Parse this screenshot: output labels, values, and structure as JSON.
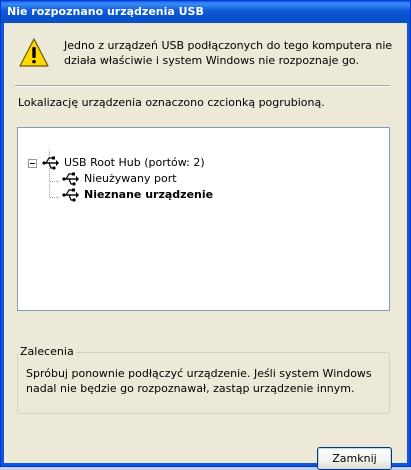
{
  "window": {
    "title": "Nie rozpoznano urządzenia USB"
  },
  "message": {
    "icon": "warning-icon",
    "text": "Jedno z urządzeń USB podłączonych do tego komputera nie działa właściwie i system Windows nie rozpoznaje go."
  },
  "location_label": "Lokalizację urządzenia oznaczono czcionką pogrubioną.",
  "tree": {
    "root": {
      "label": "USB Root Hub (portów: 2)",
      "icon": "usb-icon",
      "expanded": true
    },
    "children": [
      {
        "label": "Nieużywany port",
        "icon": "usb-icon",
        "bold": false
      },
      {
        "label": "Nieznane urządzenie",
        "icon": "usb-icon",
        "bold": true
      }
    ]
  },
  "recommendation": {
    "legend": "Zalecenia",
    "text": "Spróbuj ponownie podłączyć urządzenie. Jeśli system Windows nadal nie będzie go rozpoznawał, zastąp urządzenie innym."
  },
  "buttons": {
    "close_label": "Zamknij"
  },
  "colors": {
    "titlebar": "#0c58d8",
    "dialog_bg": "#ece9d8",
    "warning_yellow": "#ffd800"
  }
}
